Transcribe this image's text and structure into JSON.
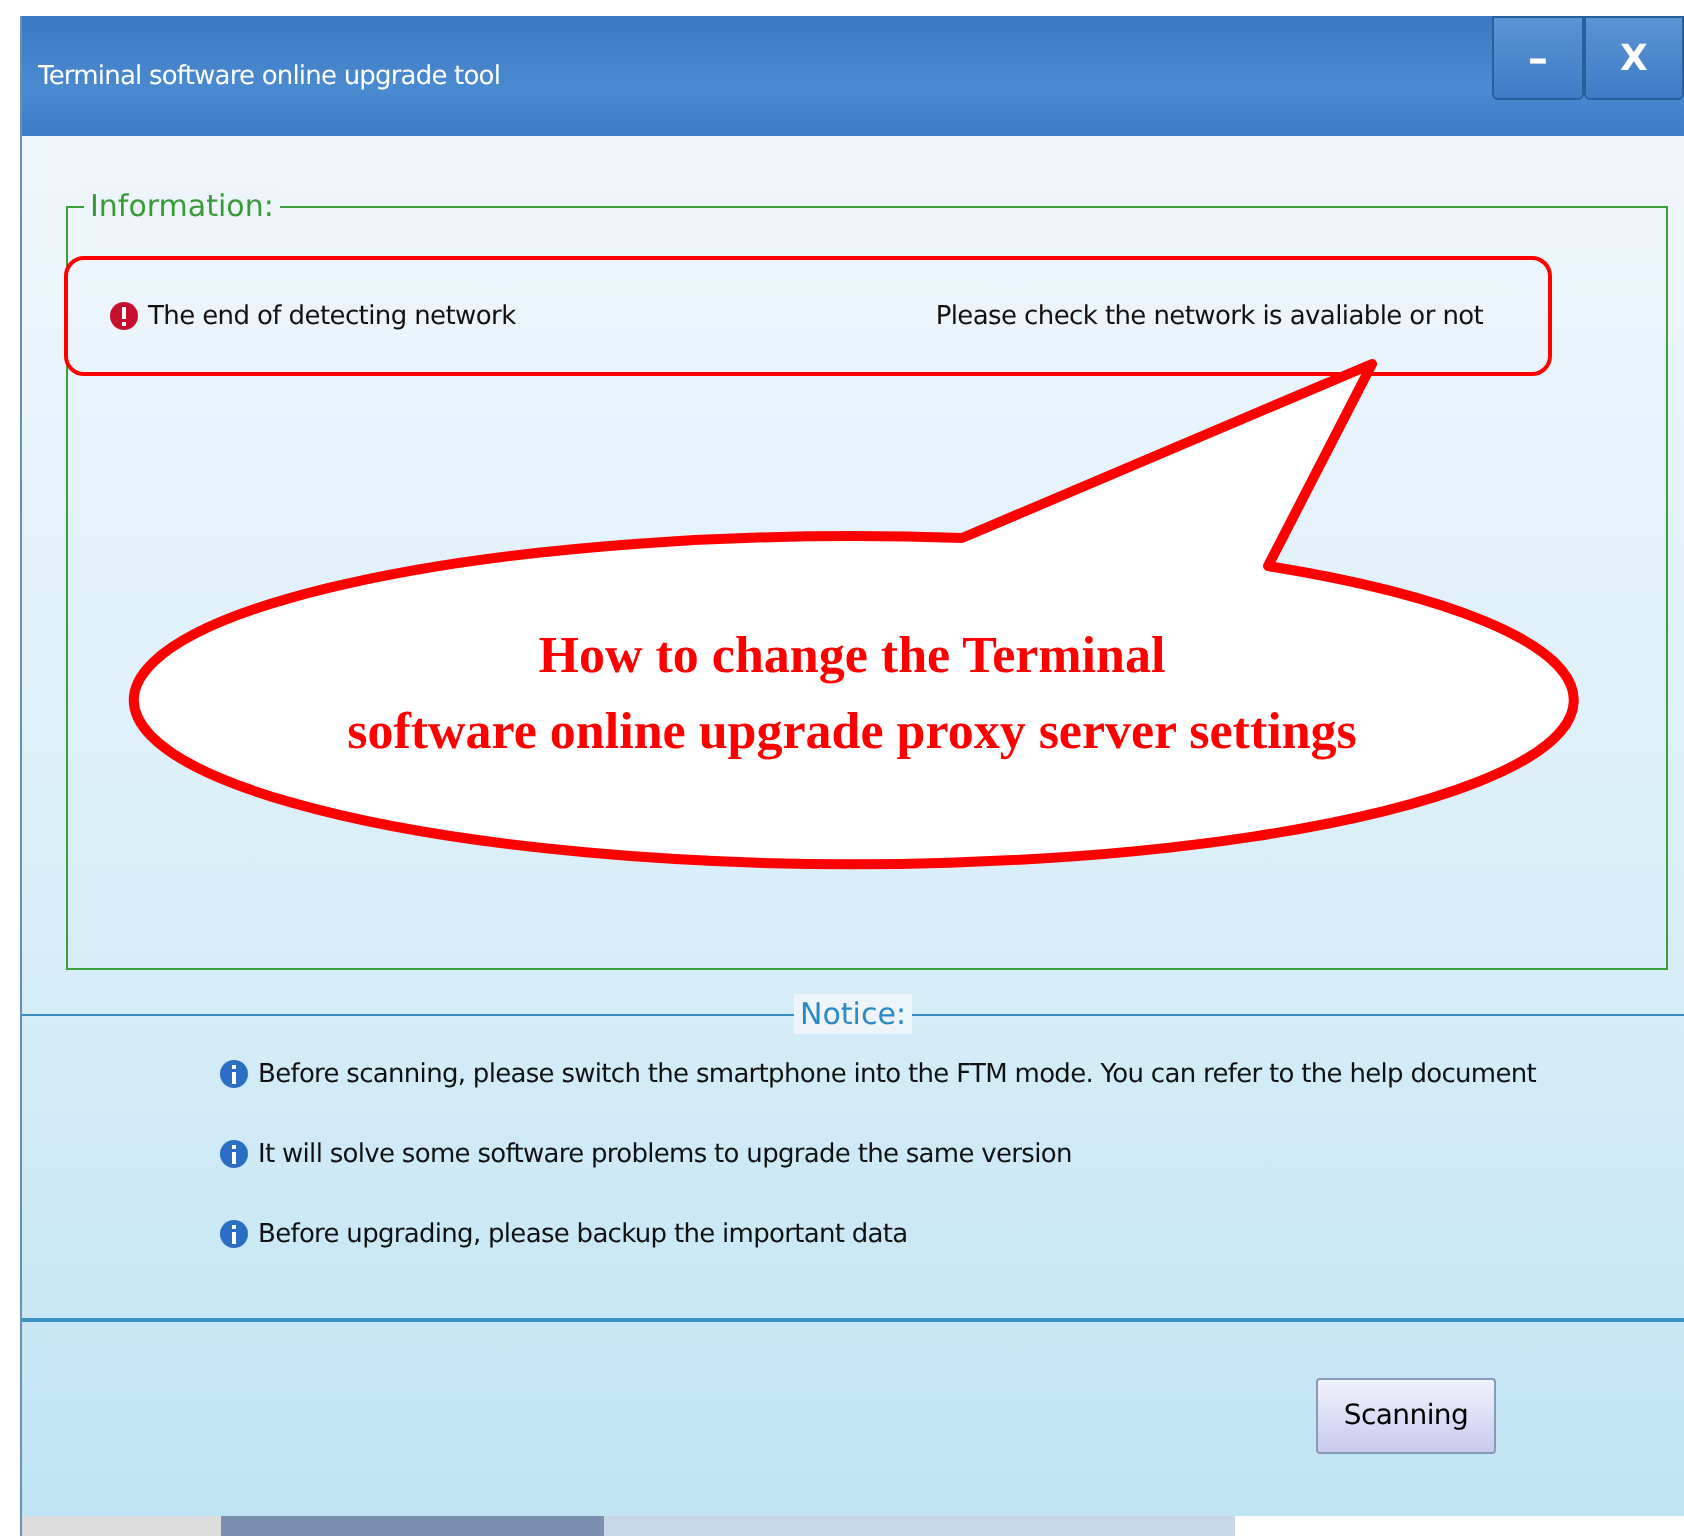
{
  "window": {
    "title": "Terminal software online upgrade tool",
    "controls": [
      {
        "kind": "minimize",
        "label": "–"
      },
      {
        "kind": "close",
        "label": "X"
      }
    ]
  },
  "information": {
    "legend": "Information:",
    "items": [
      {
        "kind": "error",
        "message": "The end of detecting network",
        "hint": "Please check the network is avaliable or not"
      }
    ]
  },
  "callout": {
    "text": "How to change the Terminal\nsoftware online upgrade proxy server settings"
  },
  "notice": {
    "legend": "Notice:",
    "items": [
      {
        "kind": "info",
        "text": "Before scanning, please switch the smartphone into the FTM mode. You can refer to the help document"
      },
      {
        "kind": "info",
        "text": "It will solve some software problems to upgrade the same version"
      },
      {
        "kind": "info",
        "text": "Before upgrading, please backup the important data"
      }
    ]
  },
  "buttons": [
    {
      "label": "Scanning"
    }
  ]
}
